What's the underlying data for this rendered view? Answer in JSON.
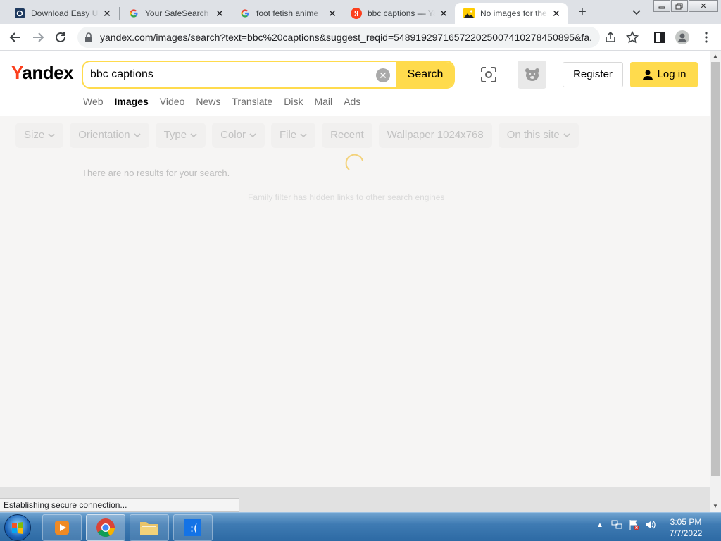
{
  "browser": {
    "tabs": [
      {
        "title": "Download Easy Uninstaller",
        "icon": "qwant-icon"
      },
      {
        "title": "Your SafeSearch Settings",
        "icon": "google-icon"
      },
      {
        "title": "foot fetish anime",
        "icon": "google-icon"
      },
      {
        "title": "bbc captions — Yandex",
        "icon": "yandex-icon"
      },
      {
        "title": "No images for the query",
        "icon": "image-icon",
        "active": true
      }
    ],
    "url": "yandex.com/images/search?text=bbc%20captions&suggest_reqid=548919297165722025007410278450895&fa..."
  },
  "header": {
    "logo_first": "Y",
    "logo_rest": "andex",
    "search_value": "bbc captions",
    "search_button": "Search",
    "register": "Register",
    "login": "Log in",
    "services": [
      "Web",
      "Images",
      "Video",
      "News",
      "Translate",
      "Disk",
      "Mail",
      "Ads"
    ],
    "active_service": "Images"
  },
  "filters": [
    {
      "label": "Size",
      "dropdown": true
    },
    {
      "label": "Orientation",
      "dropdown": true
    },
    {
      "label": "Type",
      "dropdown": true
    },
    {
      "label": "Color",
      "dropdown": true
    },
    {
      "label": "File",
      "dropdown": true
    },
    {
      "label": "Recent",
      "dropdown": false
    },
    {
      "label": "Wallpaper 1024x768",
      "dropdown": false
    },
    {
      "label": "On this site",
      "dropdown": true
    }
  ],
  "results": {
    "message": "There are no results for your search.",
    "family_filter": "Family filter has hidden links to other search engines"
  },
  "status_bar": "Establishing secure connection...",
  "taskbar": {
    "time": "3:05 PM",
    "date": "7/7/2022"
  },
  "colors": {
    "yandex_yellow": "#ffdb4d",
    "yandex_red": "#fc3f1d",
    "taskbar_blue": "#3f7bb3"
  }
}
